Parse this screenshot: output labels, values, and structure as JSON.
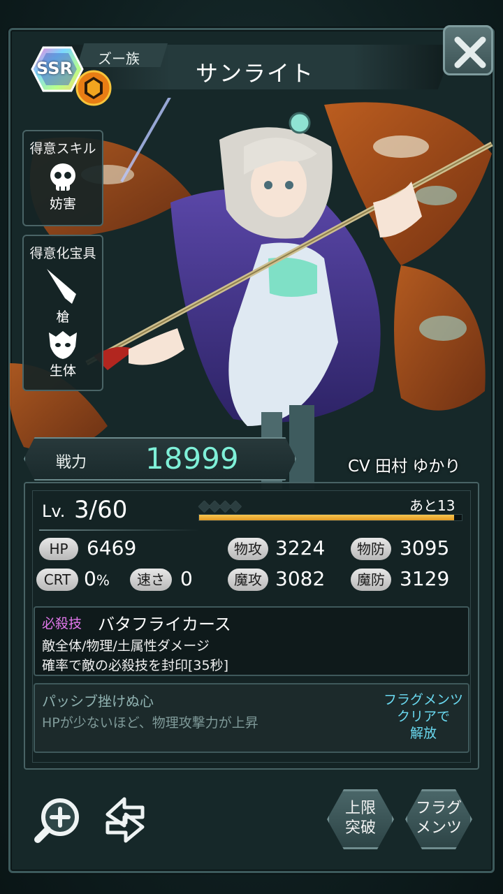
{
  "header": {
    "rarity": "SSR",
    "tribe": "ズー族",
    "name": "サンライト",
    "close_icon": "close-icon"
  },
  "side": {
    "skill_title": "得意スキル",
    "skill_type": "妨害",
    "treasure_title": "得意化宝具",
    "weapon_type": "槍",
    "target_type": "生体"
  },
  "power": {
    "label": "戦力",
    "value": "18999"
  },
  "voice": "CV 田村 ゆかり",
  "level": {
    "label": "Lv.",
    "value": "3/60",
    "remaining": "あと13",
    "exp_fraction": 0.97,
    "stars": "◆◆◆◆"
  },
  "stats": {
    "hp_label": "HP",
    "hp": "6469",
    "patk_label": "物攻",
    "patk": "3224",
    "pdef_label": "物防",
    "pdef": "3095",
    "crt_label": "CRT",
    "crt_value": "0",
    "crt_unit": "%",
    "spd_label": "速さ",
    "spd": "0",
    "matk_label": "魔攻",
    "matk": "3082",
    "mdef_label": "魔防",
    "mdef": "3129"
  },
  "special": {
    "tag": "必殺技",
    "name": "バタフライカース",
    "line1": "敵全体/物理/土属性ダメージ",
    "line2": "確率で敵の必殺技を封印[35秒]"
  },
  "passive": {
    "name": "パッシブ挫けぬ心",
    "desc": "HPが少ないほど、物理攻撃力が上昇",
    "unlock_line1": "フラグメンツ",
    "unlock_line2": "クリアで",
    "unlock_line3": "解放"
  },
  "buttons": {
    "limit_break_line1": "上限",
    "limit_break_line2": "突破",
    "fragments_line1": "フラグ",
    "fragments_line2": "メンツ"
  },
  "colors": {
    "power_value": "#7ff0d8",
    "special_tag": "#e278ec",
    "unlock_note": "#6ad9f0",
    "exp_bar": "#f0b03a"
  }
}
